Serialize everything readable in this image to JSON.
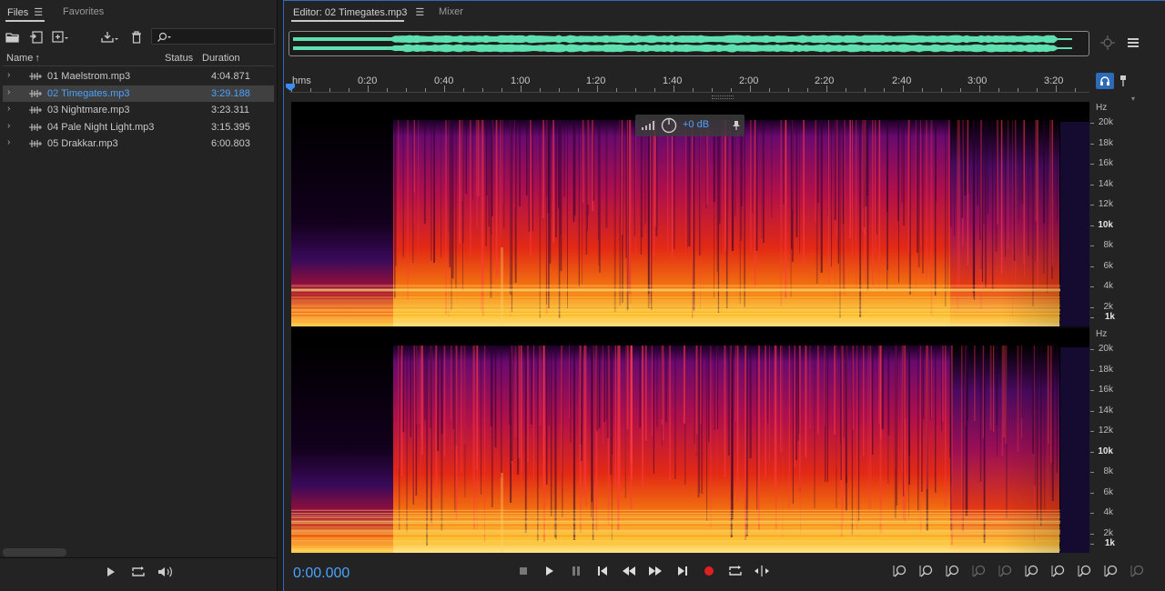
{
  "files_panel": {
    "tab_files": "Files",
    "tab_favorites": "Favorites",
    "col_name": "Name",
    "col_status": "Status",
    "col_duration": "Duration",
    "files": [
      {
        "name": "01 Maelstrom.mp3",
        "duration": "4:04.871",
        "selected": false
      },
      {
        "name": "02 Timegates.mp3",
        "duration": "3:29.188",
        "selected": true
      },
      {
        "name": "03 Nightmare.mp3",
        "duration": "3:23.311",
        "selected": false
      },
      {
        "name": "04 Pale Night Light.mp3",
        "duration": "3:15.395",
        "selected": false
      },
      {
        "name": "05 Drakkar.mp3",
        "duration": "6:00.803",
        "selected": false
      }
    ]
  },
  "editor": {
    "tab_editor": "Editor: 02 Timegates.mp3",
    "tab_mixer": "Mixer",
    "ruler_unit": "hms",
    "ruler_labels": [
      "0:20",
      "0:40",
      "1:00",
      "1:20",
      "1:40",
      "2:00",
      "2:20",
      "2:40",
      "3:00",
      "3:20"
    ],
    "hud_gain": "+0 dB",
    "hz_unit": "Hz",
    "hz_labels": [
      "20k",
      "18k",
      "16k",
      "14k",
      "12k",
      "10k",
      "8k",
      "6k",
      "4k",
      "2k",
      "1k"
    ],
    "time_display": "0:00.000"
  },
  "colors": {
    "accent": "#4aa3ff",
    "waveform": "#5fe0b0",
    "record": "#e02020",
    "selection_border": "#2d6ab8"
  }
}
